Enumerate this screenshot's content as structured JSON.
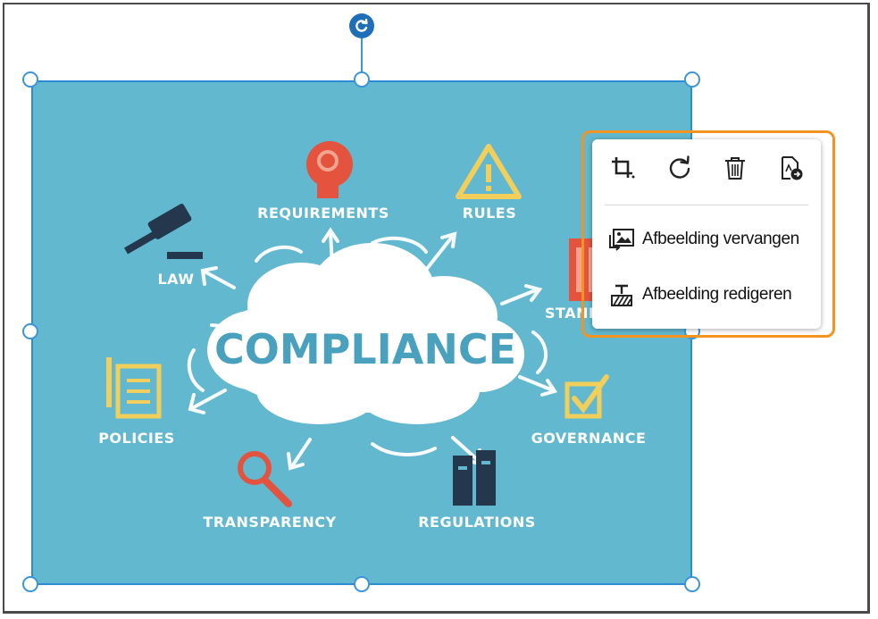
{
  "canvas": {
    "image": {
      "center_title": "COMPLIANCE",
      "labels": {
        "requirements": "REQUIREMENTS",
        "rules": "RULES",
        "law": "LAW",
        "standards": "STANDARDS",
        "policies": "POLICIES",
        "governance": "GOVERNANCE",
        "transparency": "TRANSPARENCY",
        "regulations": "REGULATIONS"
      },
      "background_color": "#62b8cf"
    },
    "selection_color": "#3c95d8"
  },
  "context_menu": {
    "highlight_color": "#f39320",
    "icons": [
      "crop-icon",
      "rotate-icon",
      "delete-icon",
      "extract-image-icon"
    ],
    "items": [
      {
        "label": "Afbeelding vervangen",
        "icon": "replace-image-icon"
      },
      {
        "label": "Afbeelding redigeren",
        "icon": "edit-image-icon"
      }
    ]
  }
}
